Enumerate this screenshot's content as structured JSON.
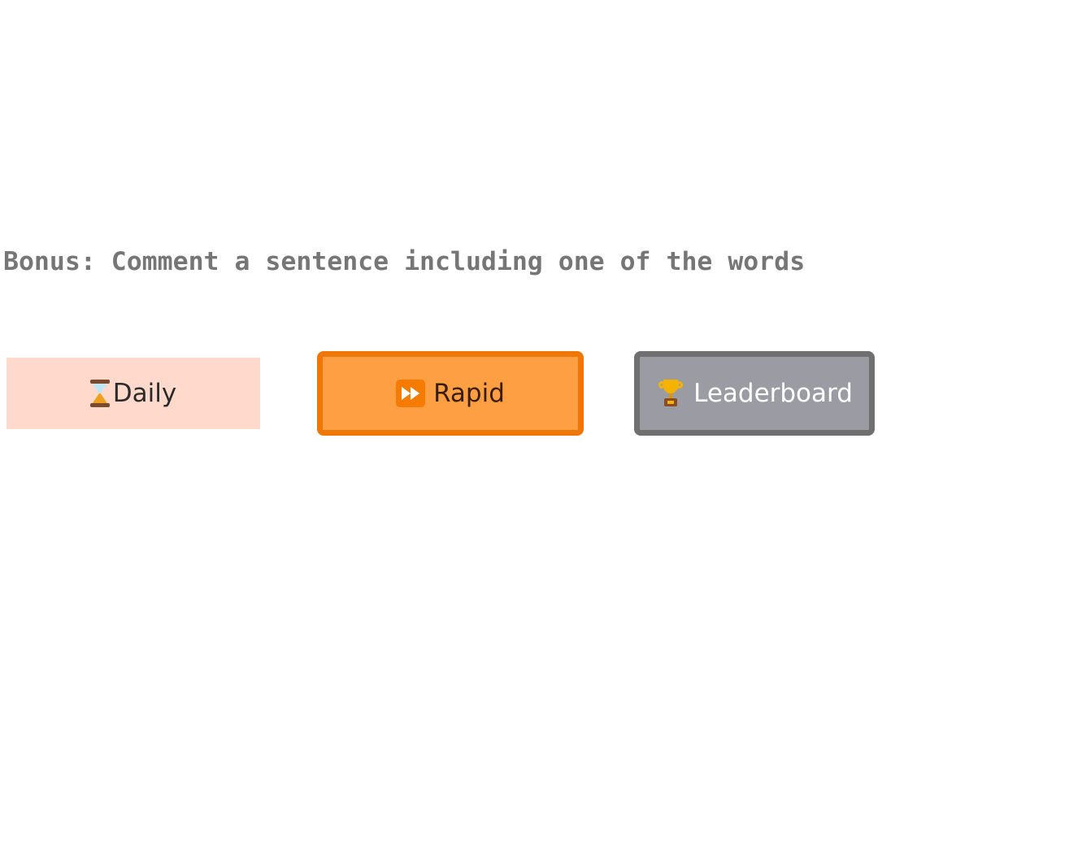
{
  "bonus": {
    "text": "Bonus: Comment a sentence including one of the words"
  },
  "modes": {
    "daily": {
      "label": "Daily",
      "icon": "hourglass-icon"
    },
    "rapid": {
      "label": "Rapid",
      "icon": "fast-forward-icon"
    },
    "leaderboard": {
      "label": "Leaderboard",
      "icon": "trophy-icon"
    }
  },
  "colors": {
    "daily_bg": "#ffdacc",
    "rapid_bg": "#fe9f43",
    "rapid_border": "#f07606",
    "leaderboard_bg": "#9b9ba3",
    "leaderboard_border": "#707070",
    "bonus_text": "#767676"
  }
}
